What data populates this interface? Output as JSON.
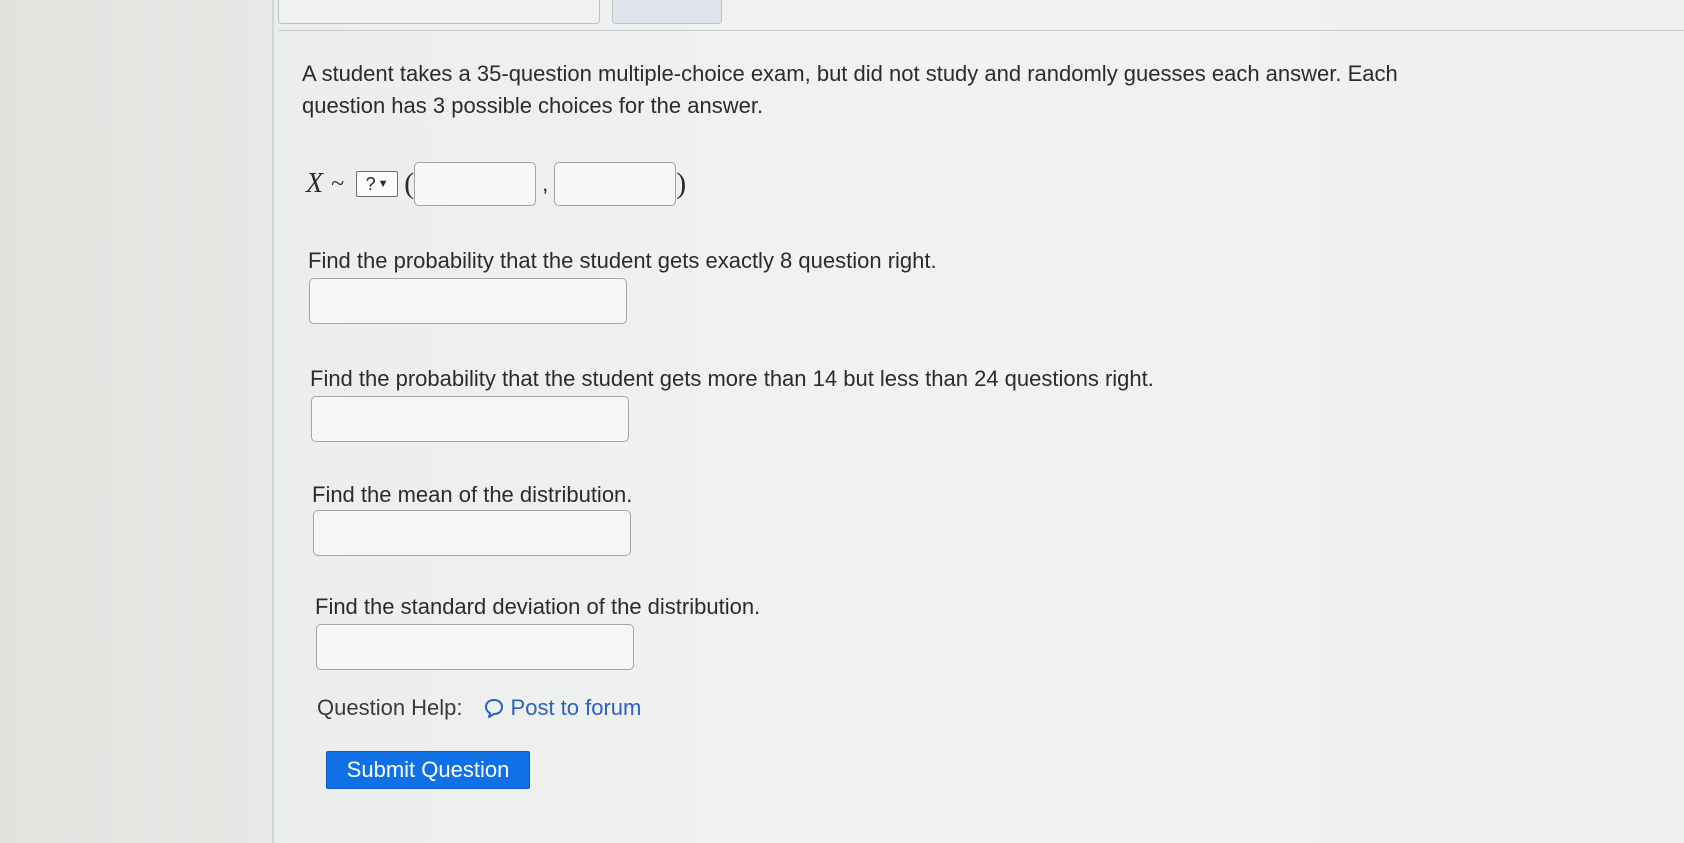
{
  "problem": {
    "prompt": "A student takes a 35-question multiple-choice exam, but did not study and randomly guesses each answer. Each question has 3 possible choices for the answer."
  },
  "distribution": {
    "variable": "X",
    "tilde": "~",
    "selected_option": "?",
    "open_paren": "(",
    "separator": ",",
    "close_paren": ")",
    "param1_value": "",
    "param2_value": ""
  },
  "questions": [
    {
      "text": "Find the probability that the student gets exactly 8 question right.",
      "value": ""
    },
    {
      "text": "Find the probability that the student gets more than 14 but less than 24 questions right.",
      "value": ""
    },
    {
      "text": "Find the mean of the distribution.",
      "value": ""
    },
    {
      "text": "Find the standard deviation of the distribution.",
      "value": ""
    }
  ],
  "help": {
    "label": "Question Help:",
    "forum_link": "Post to forum",
    "icon": "speech-bubble-icon"
  },
  "submit": {
    "label": "Submit Question"
  },
  "colors": {
    "link": "#2a62c2",
    "submit_bg": "#1070e6",
    "submit_text": "#ffffff"
  }
}
